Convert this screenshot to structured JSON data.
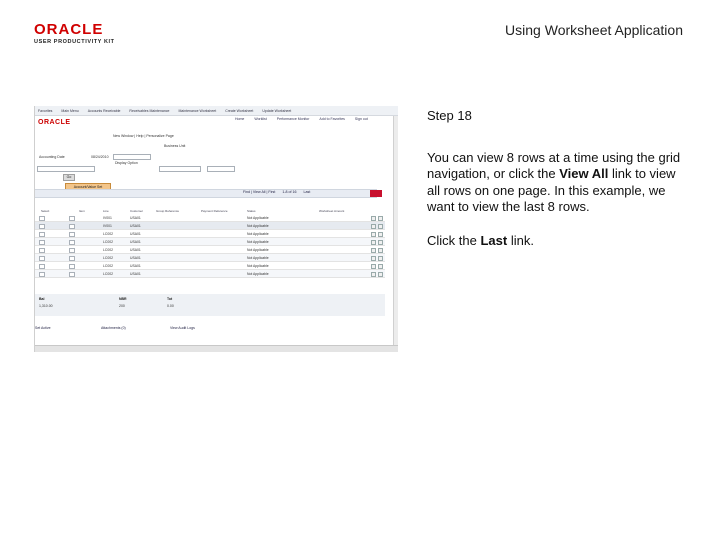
{
  "header": {
    "brand": "ORACLE",
    "brand_sub": "USER PRODUCTIVITY KIT",
    "title": "Using Worksheet Application"
  },
  "instructions": {
    "step": "Step 18",
    "para1_pre": "You can view 8 rows at a time using the grid navigation, or click the ",
    "para1_link": "View All",
    "para1_post": " link to view all rows on one page. In this example, we want to view the last 8 rows.",
    "para2_pre": "Click the ",
    "para2_link": "Last",
    "para2_post": " link."
  },
  "screenshot": {
    "logo": "ORACLE",
    "topnav": [
      "Favorites",
      "Main Menu",
      "Accounts Receivable",
      "Receivables Maintenance",
      "Maintenance Worksheet",
      "Create Worksheet",
      "Update Worksheet"
    ],
    "subnav": [
      "Home",
      "Worklist",
      "Performance Monitor",
      "Add to Favorites",
      "Sign out"
    ],
    "new_window": "New Window | Help | Personalize Page",
    "unit_label": "Accounting Date",
    "unit_value": "08/24/2010",
    "business_unit_label": "Business Unit",
    "display_option": "Display Option",
    "go_button": "Go",
    "account_button": "Account/Value Set",
    "find_nav": "Find | View All | First",
    "range": "1-8 of 16",
    "last_link": "Last",
    "columns": [
      "Select",
      "Item",
      "Line",
      "Customer",
      "Group Reference",
      "Payment Reference",
      "Status",
      "Worksheet Amount"
    ],
    "rows": [
      {
        "item": "IV001",
        "cust": "USA01",
        "status": "Not Applicable"
      },
      {
        "item": "IV001",
        "cust": "USA01",
        "status": "Not Applicable"
      },
      {
        "item": "LC002",
        "cust": "USA01",
        "status": "Not Applicable"
      },
      {
        "item": "LC002",
        "cust": "USA01",
        "status": "Not Applicable"
      },
      {
        "item": "LC002",
        "cust": "USA01",
        "status": "Not Applicable"
      },
      {
        "item": "LC002",
        "cust": "USA01",
        "status": "Not Applicable"
      },
      {
        "item": "LC002",
        "cust": "USA01",
        "status": "Not Applicable"
      },
      {
        "item": "LC002",
        "cust": "USA01",
        "status": "Not Applicable"
      }
    ],
    "totals": {
      "bal_label": "Bal",
      "bal_value": "1,310.00",
      "nbr_label": "NBR",
      "nbr_value": "200",
      "tot_label": "Tot",
      "tot_value": "0.00"
    },
    "footer_links": [
      "Set Active",
      "Attachments (0)",
      "View Audit Logs"
    ]
  }
}
